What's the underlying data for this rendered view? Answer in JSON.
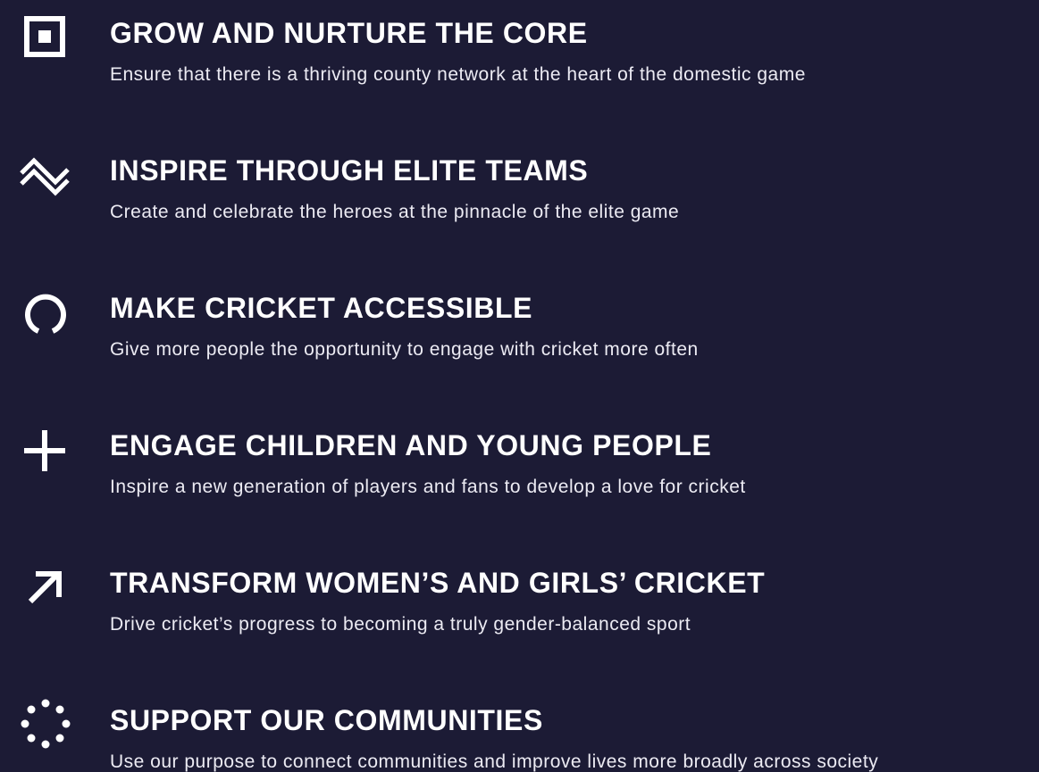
{
  "pillars": [
    {
      "icon": "square-target-icon",
      "title": "GROW AND NURTURE THE CORE",
      "description": "Ensure that there is a thriving county network at the heart of the domestic game"
    },
    {
      "icon": "zigzag-chevron-icon",
      "title": "INSPIRE THROUGH ELITE TEAMS",
      "description": "Create and celebrate the heroes at the pinnacle of the elite game"
    },
    {
      "icon": "open-ring-icon",
      "title": "MAKE CRICKET ACCESSIBLE",
      "description": "Give more people the opportunity to engage with cricket more often"
    },
    {
      "icon": "plus-icon",
      "title": "ENGAGE CHILDREN AND YOUNG PEOPLE",
      "description": "Inspire a new generation of players and fans to develop a love for cricket"
    },
    {
      "icon": "arrow-up-right-icon",
      "title": "TRANSFORM WOMEN’S AND GIRLS’ CRICKET",
      "description": "Drive cricket’s progress to becoming a truly gender-balanced sport"
    },
    {
      "icon": "dotted-circle-icon",
      "title": "SUPPORT OUR COMMUNITIES",
      "description": "Use our purpose to connect communities and improve lives more broadly across society"
    }
  ],
  "colors": {
    "background": "#1c1b35",
    "text": "#ffffff"
  }
}
